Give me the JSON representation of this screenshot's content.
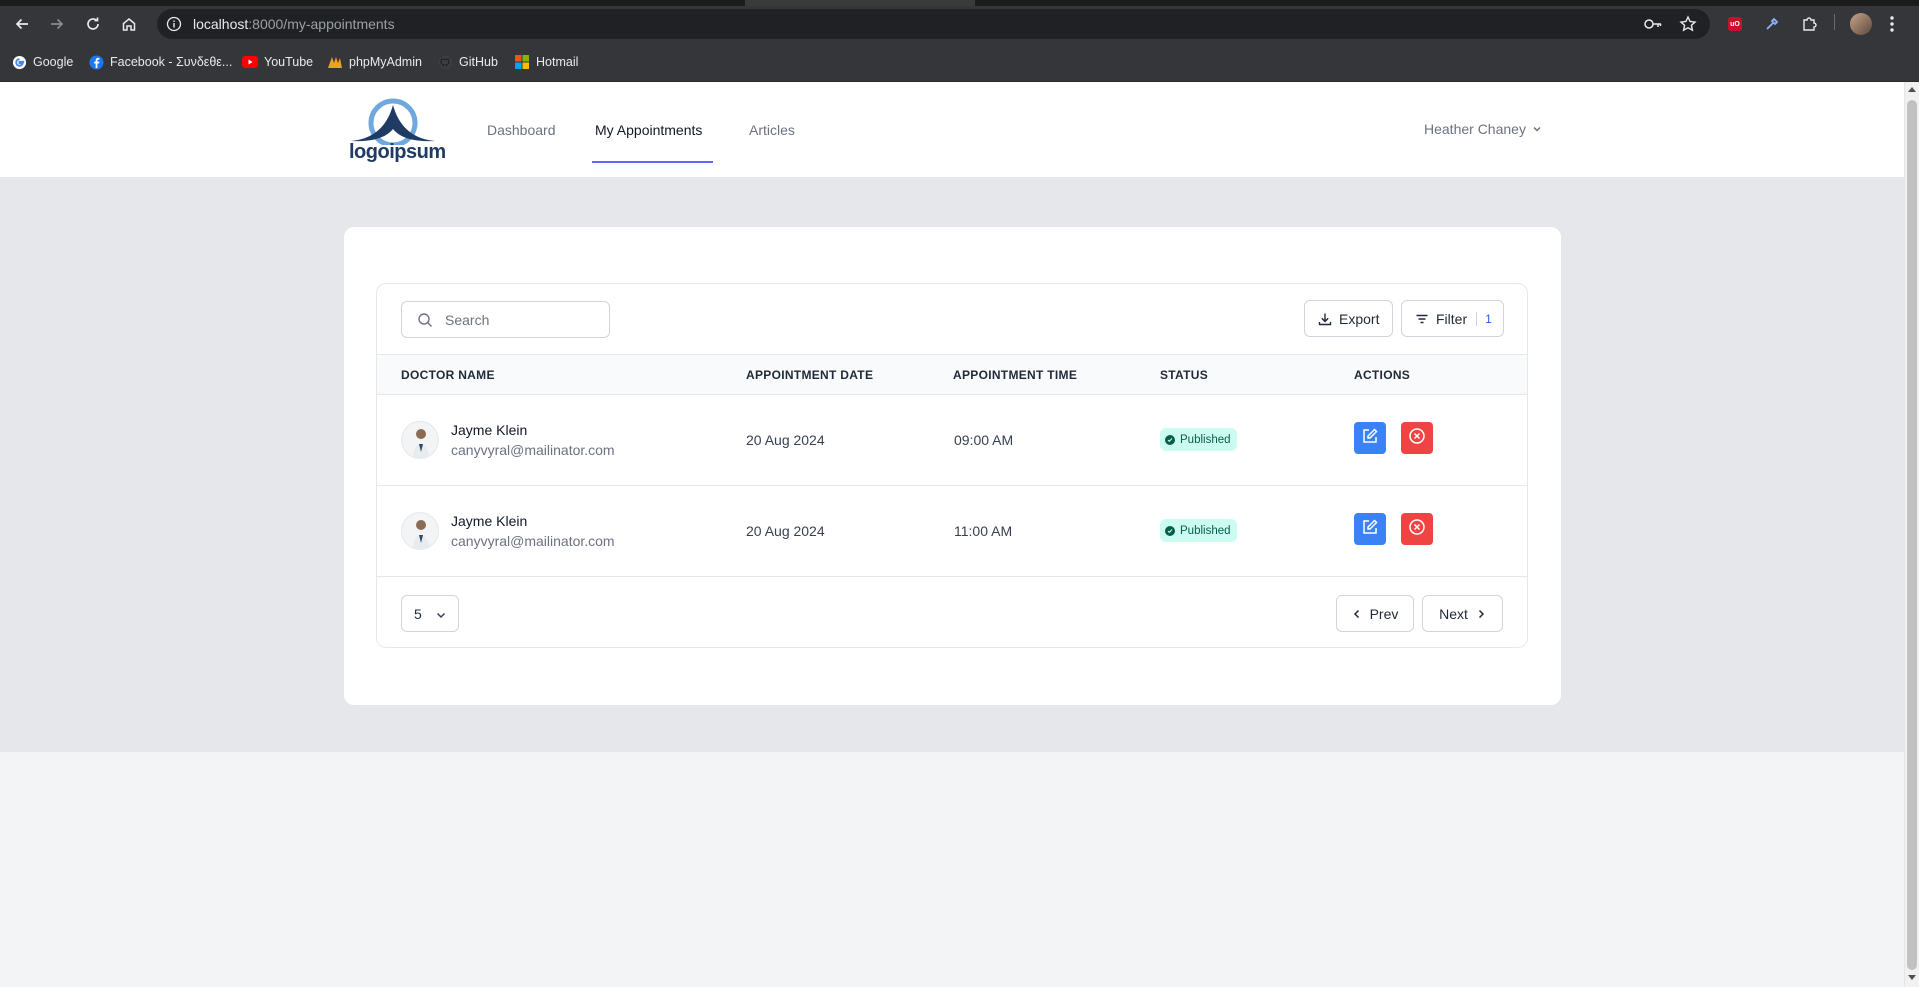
{
  "browser": {
    "url_host": "localhost",
    "url_path": ":8000/my-appointments",
    "bookmarks": [
      {
        "label": "Google",
        "icon": "google-icon"
      },
      {
        "label": "Facebook - Συνδεθε...",
        "icon": "facebook-icon"
      },
      {
        "label": "YouTube",
        "icon": "youtube-icon"
      },
      {
        "label": "phpMyAdmin",
        "icon": "phpmyadmin-icon"
      },
      {
        "label": "GitHub",
        "icon": "github-icon"
      },
      {
        "label": "Hotmail",
        "icon": "microsoft-icon"
      }
    ],
    "extension_badge": "uO"
  },
  "header": {
    "logo_text": "logoipsum",
    "nav": [
      {
        "label": "Dashboard",
        "active": false
      },
      {
        "label": "My Appointments",
        "active": true
      },
      {
        "label": "Articles",
        "active": false
      }
    ],
    "user_name": "Heather Chaney",
    "accent_color": "#6366f1"
  },
  "table": {
    "search_placeholder": "Search",
    "export_label": "Export",
    "filter_label": "Filter",
    "filter_count": "1",
    "columns": [
      "DOCTOR NAME",
      "APPOINTMENT DATE",
      "APPOINTMENT TIME",
      "STATUS",
      "ACTIONS"
    ],
    "rows": [
      {
        "name": "Jayme Klein",
        "email": "canyvyral@mailinator.com",
        "date": "20 Aug 2024",
        "time": "09:00 AM",
        "status": "Published"
      },
      {
        "name": "Jayme Klein",
        "email": "canyvyral@mailinator.com",
        "date": "20 Aug 2024",
        "time": "11:00 AM",
        "status": "Published"
      }
    ],
    "per_page": "5",
    "prev_label": "Prev",
    "next_label": "Next",
    "colors": {
      "edit": "#3b82f6",
      "delete": "#ef4444",
      "status_bg": "#ccfbf1",
      "status_text": "#065f46"
    }
  }
}
